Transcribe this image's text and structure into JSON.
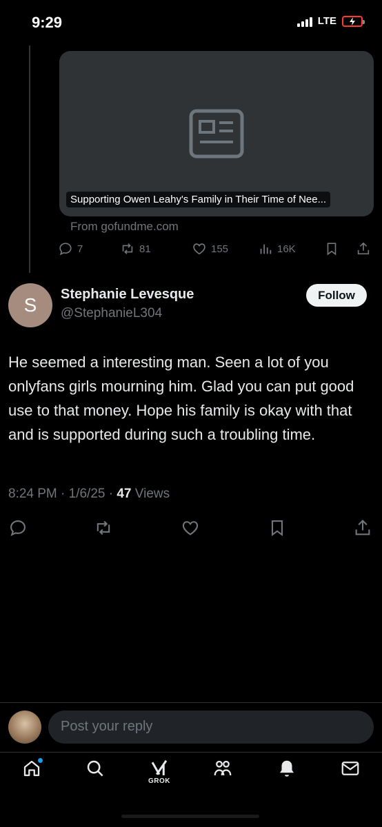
{
  "status_bar": {
    "time": "9:29",
    "network": "LTE",
    "battery_color": "#ff3b30"
  },
  "link_card": {
    "icon": "article-icon",
    "title": "Supporting Owen Leahy's Family in Their Time of Nee...",
    "source": "From gofundme.com"
  },
  "previous_post": {
    "actions": {
      "replies": "7",
      "reposts": "81",
      "likes": "155",
      "views": "16K"
    }
  },
  "tweet": {
    "avatar_letter": "S",
    "author_name": "Stephanie Levesque",
    "author_handle": "@StephanieL304",
    "follow_label": "Follow",
    "text": "He seemed a interesting  man. Seen a lot of you onlyfans girls mourning him. Glad you can put good use to that money. Hope his family is okay with that and is supported during such a troubling time.",
    "timestamp": "8:24 PM · 1/6/25 · ",
    "views_count": "47",
    "views_label": " Views"
  },
  "reply_bar": {
    "placeholder": "Post your reply"
  },
  "tab_bar": {
    "grok_label": "GROK",
    "accent": "#1d9bf0",
    "items": [
      "home-icon",
      "search-icon",
      "grok-icon",
      "communities-icon",
      "notifications-icon",
      "messages-icon"
    ]
  }
}
